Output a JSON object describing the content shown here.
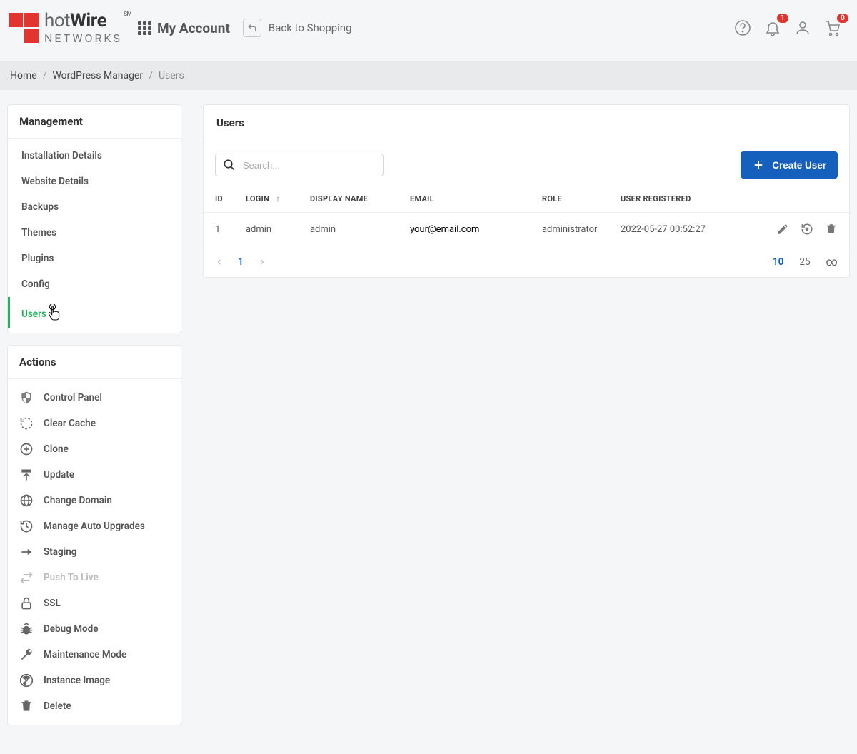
{
  "header": {
    "brand_top": "hot",
    "brand_top_bold": "Wire",
    "brand_sm": "SM",
    "brand_bottom": "NETWORKS",
    "my_account": "My Account",
    "back_shopping": "Back to Shopping",
    "notif_count": "1",
    "cart_count": "0"
  },
  "breadcrumb": {
    "home": "Home",
    "wp": "WordPress Manager",
    "current": "Users"
  },
  "sidebar": {
    "mgmt_title": "Management",
    "mgmt": {
      "install": "Installation Details",
      "website": "Website Details",
      "backups": "Backups",
      "themes": "Themes",
      "plugins": "Plugins",
      "config": "Config",
      "users": "Users"
    },
    "actions_title": "Actions",
    "actions": {
      "control_panel": "Control Panel",
      "clear_cache": "Clear Cache",
      "clone": "Clone",
      "update": "Update",
      "change_domain": "Change Domain",
      "auto_upgrades": "Manage Auto Upgrades",
      "staging": "Staging",
      "push_live": "Push To Live",
      "ssl": "SSL",
      "debug": "Debug Mode",
      "maintenance": "Maintenance Mode",
      "instance_image": "Instance Image",
      "delete": "Delete"
    }
  },
  "main": {
    "title": "Users",
    "search_placeholder": "Search...",
    "create_btn": "Create User",
    "columns": {
      "id": "ID",
      "login": "LOGIN",
      "display_name": "DISPLAY NAME",
      "email": "EMAIL",
      "role": "ROLE",
      "registered": "USER REGISTERED"
    },
    "row": {
      "id": "1",
      "login": "admin",
      "display_name": "admin",
      "email": "your@email.com",
      "role": "administrator",
      "registered": "2022-05-27 00:52:27"
    },
    "pager": {
      "page": "1",
      "size_10": "10",
      "size_25": "25",
      "size_inf": "∞"
    }
  }
}
